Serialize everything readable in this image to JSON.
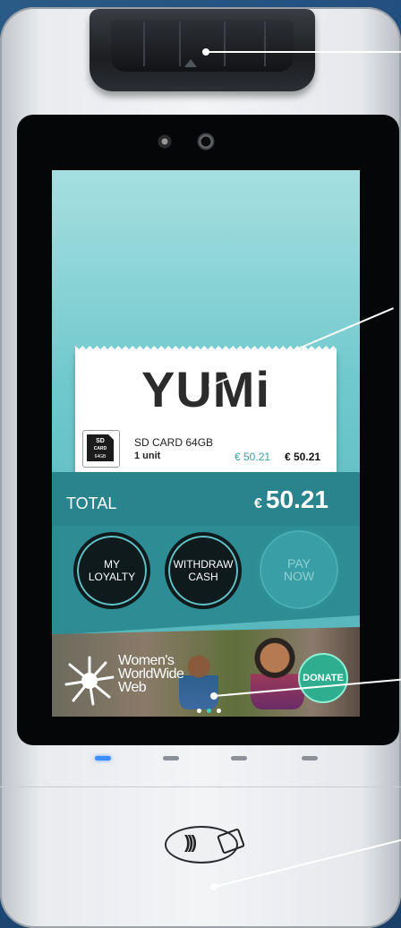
{
  "receipt": {
    "brand": "YUMi",
    "item": {
      "icon_label": "SD CARD 64GB",
      "icon_text_top": "SD",
      "icon_text_mid": "CARD",
      "icon_text_bottom": "64GB",
      "name": "SD CARD 64GB",
      "quantity": "1 unit",
      "unit_price": "€ 50.21",
      "line_total": "€ 50.21"
    }
  },
  "total": {
    "label": "TOTAL",
    "currency": "€",
    "amount": "50.21"
  },
  "buttons": {
    "loyalty_line1": "MY",
    "loyalty_line2": "LOYALTY",
    "withdraw_line1": "WITHDRAW",
    "withdraw_line2": "CASH",
    "pay_line1": "PAY",
    "pay_line2": "NOW"
  },
  "ad": {
    "line1": "Women's",
    "line2": "WorldWide",
    "line3": "Web",
    "donate_label": "DONATE",
    "carousel_active": 2
  },
  "colors": {
    "accent": "#2e8c95",
    "screen_top": "#a6dfe0",
    "donate": "#2fae8f",
    "led_active": "#3d8cff"
  },
  "icons": {
    "nfc": "contactless-icon"
  }
}
